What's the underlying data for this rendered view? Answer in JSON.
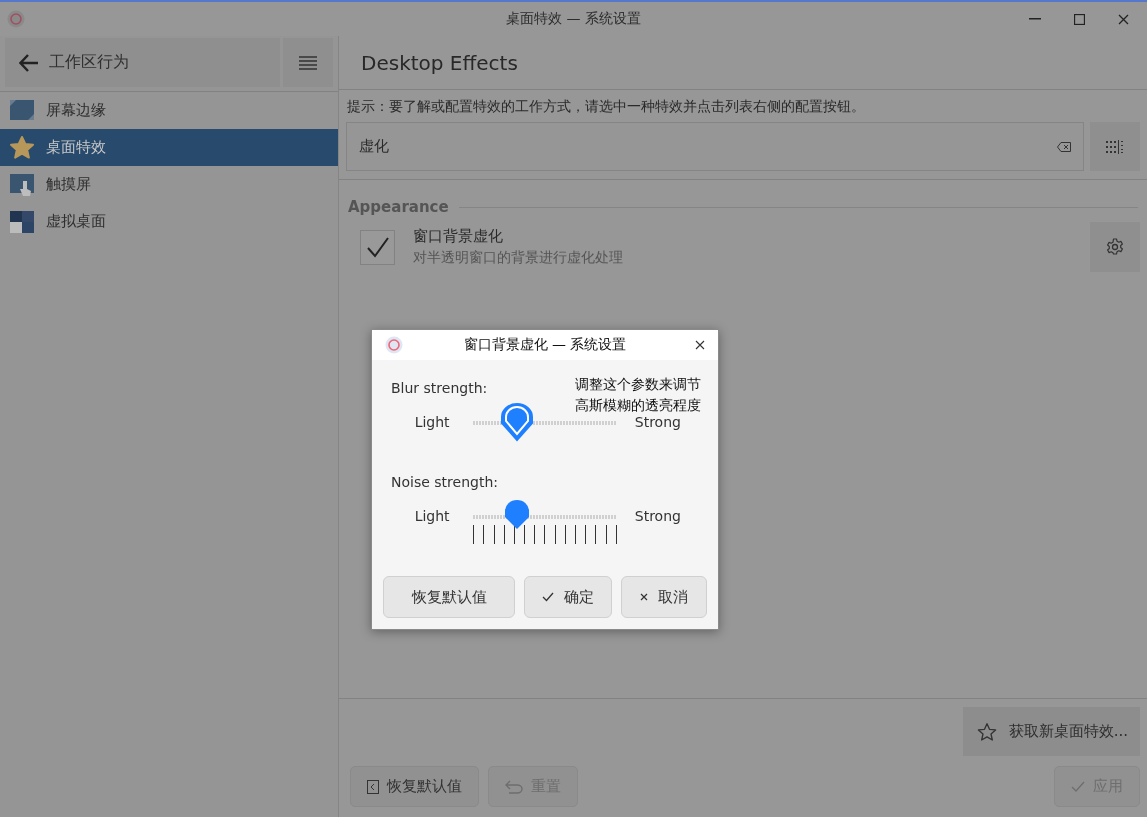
{
  "window": {
    "title": "桌面特效 — 系统设置"
  },
  "sidebar": {
    "back_label": "工作区行为",
    "items": [
      {
        "label": "屏幕边缘",
        "selected": false
      },
      {
        "label": "桌面特效",
        "selected": true
      },
      {
        "label": "触摸屏",
        "selected": false
      },
      {
        "label": "虚拟桌面",
        "selected": false
      }
    ]
  },
  "page": {
    "title": "Desktop Effects",
    "hint": "提示：要了解或配置特效的工作方式，请选中一种特效并点击列表右侧的配置按钮。",
    "search": {
      "value": "虚化"
    },
    "groups": [
      {
        "title": "Appearance",
        "effects": [
          {
            "name": "窗口背景虚化",
            "description": "对半透明窗口的背景进行虚化处理",
            "checked": true
          }
        ]
      }
    ],
    "get_new_button": "获取新桌面特效...",
    "buttons": [
      {
        "label": "恢复默认值",
        "kind": "defaults",
        "disabled": false
      },
      {
        "label": "重置",
        "kind": "reset",
        "disabled": true
      },
      {
        "label": "应用",
        "kind": "apply",
        "disabled": true
      }
    ]
  },
  "dialog": {
    "title": "窗口背景虚化 — 系统设置",
    "tooltip": [
      "调整这个参数来调节",
      "高斯模糊的透亮程度"
    ],
    "sliders": [
      {
        "label": "Blur strength:",
        "min_label": "Light",
        "max_label": "Strong",
        "level": 0.29,
        "focused": true,
        "kind": "plain"
      },
      {
        "label": "Noise strength:",
        "min_label": "Light",
        "max_label": "Strong",
        "level": 0.29,
        "focused": false,
        "kind": "ticked"
      }
    ],
    "buttons": [
      {
        "label": "恢复默认值",
        "kind": "plain"
      },
      {
        "label": "确定",
        "kind": "ok"
      },
      {
        "label": "取消",
        "kind": "cancel"
      }
    ]
  }
}
